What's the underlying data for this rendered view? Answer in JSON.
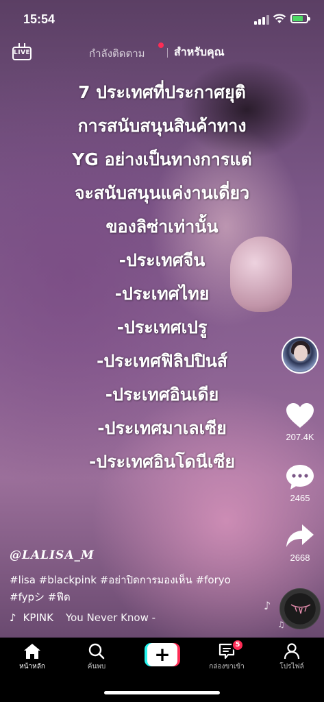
{
  "status_bar": {
    "time": "15:54"
  },
  "header": {
    "live_label": "LIVE",
    "tab_following": "กำลังติดตาม",
    "tab_for_you": "สำหรับคุณ"
  },
  "overlay_text": [
    "7 ประเทศที่ประกาศยุติ",
    "การสนับสนุนสินค้าทาง",
    "YG อย่างเป็นทางการแต่",
    "จะสนับสนุนแค่งานเดี่ยว",
    "ของลิซ่าเท่านั้น",
    "-ประเทศจีน",
    "-ประเทศไทย",
    "-ประเทศเปรู",
    "-ประเทศฟิลิปปินส์",
    "-ประเทศอินเดีย",
    "-ประเทศมาเลเซีย",
    "-ประเทศอินโดนีเซีย"
  ],
  "rail": {
    "likes": "207.4K",
    "comments": "2465",
    "shares": "2668"
  },
  "post": {
    "username": "@𝑳𝑨𝑳𝑰𝑺𝑨_𝑴",
    "caption_line1": "#lisa #blackpink #อย่าปิดการมองเห็น #foryo",
    "caption_line2": "#fypシ #ฟีด",
    "music_artist": "KPINK",
    "music_title": "You Never Know -"
  },
  "nav": {
    "home": "หน้าหลัก",
    "discover": "ค้นพบ",
    "inbox": "กล่องขาเข้า",
    "inbox_badge": "5",
    "profile": "โปรไฟล์"
  },
  "colors": {
    "accent_red": "#fe2c55",
    "accent_cyan": "#25f4ee",
    "battery_green": "#4cd964"
  }
}
